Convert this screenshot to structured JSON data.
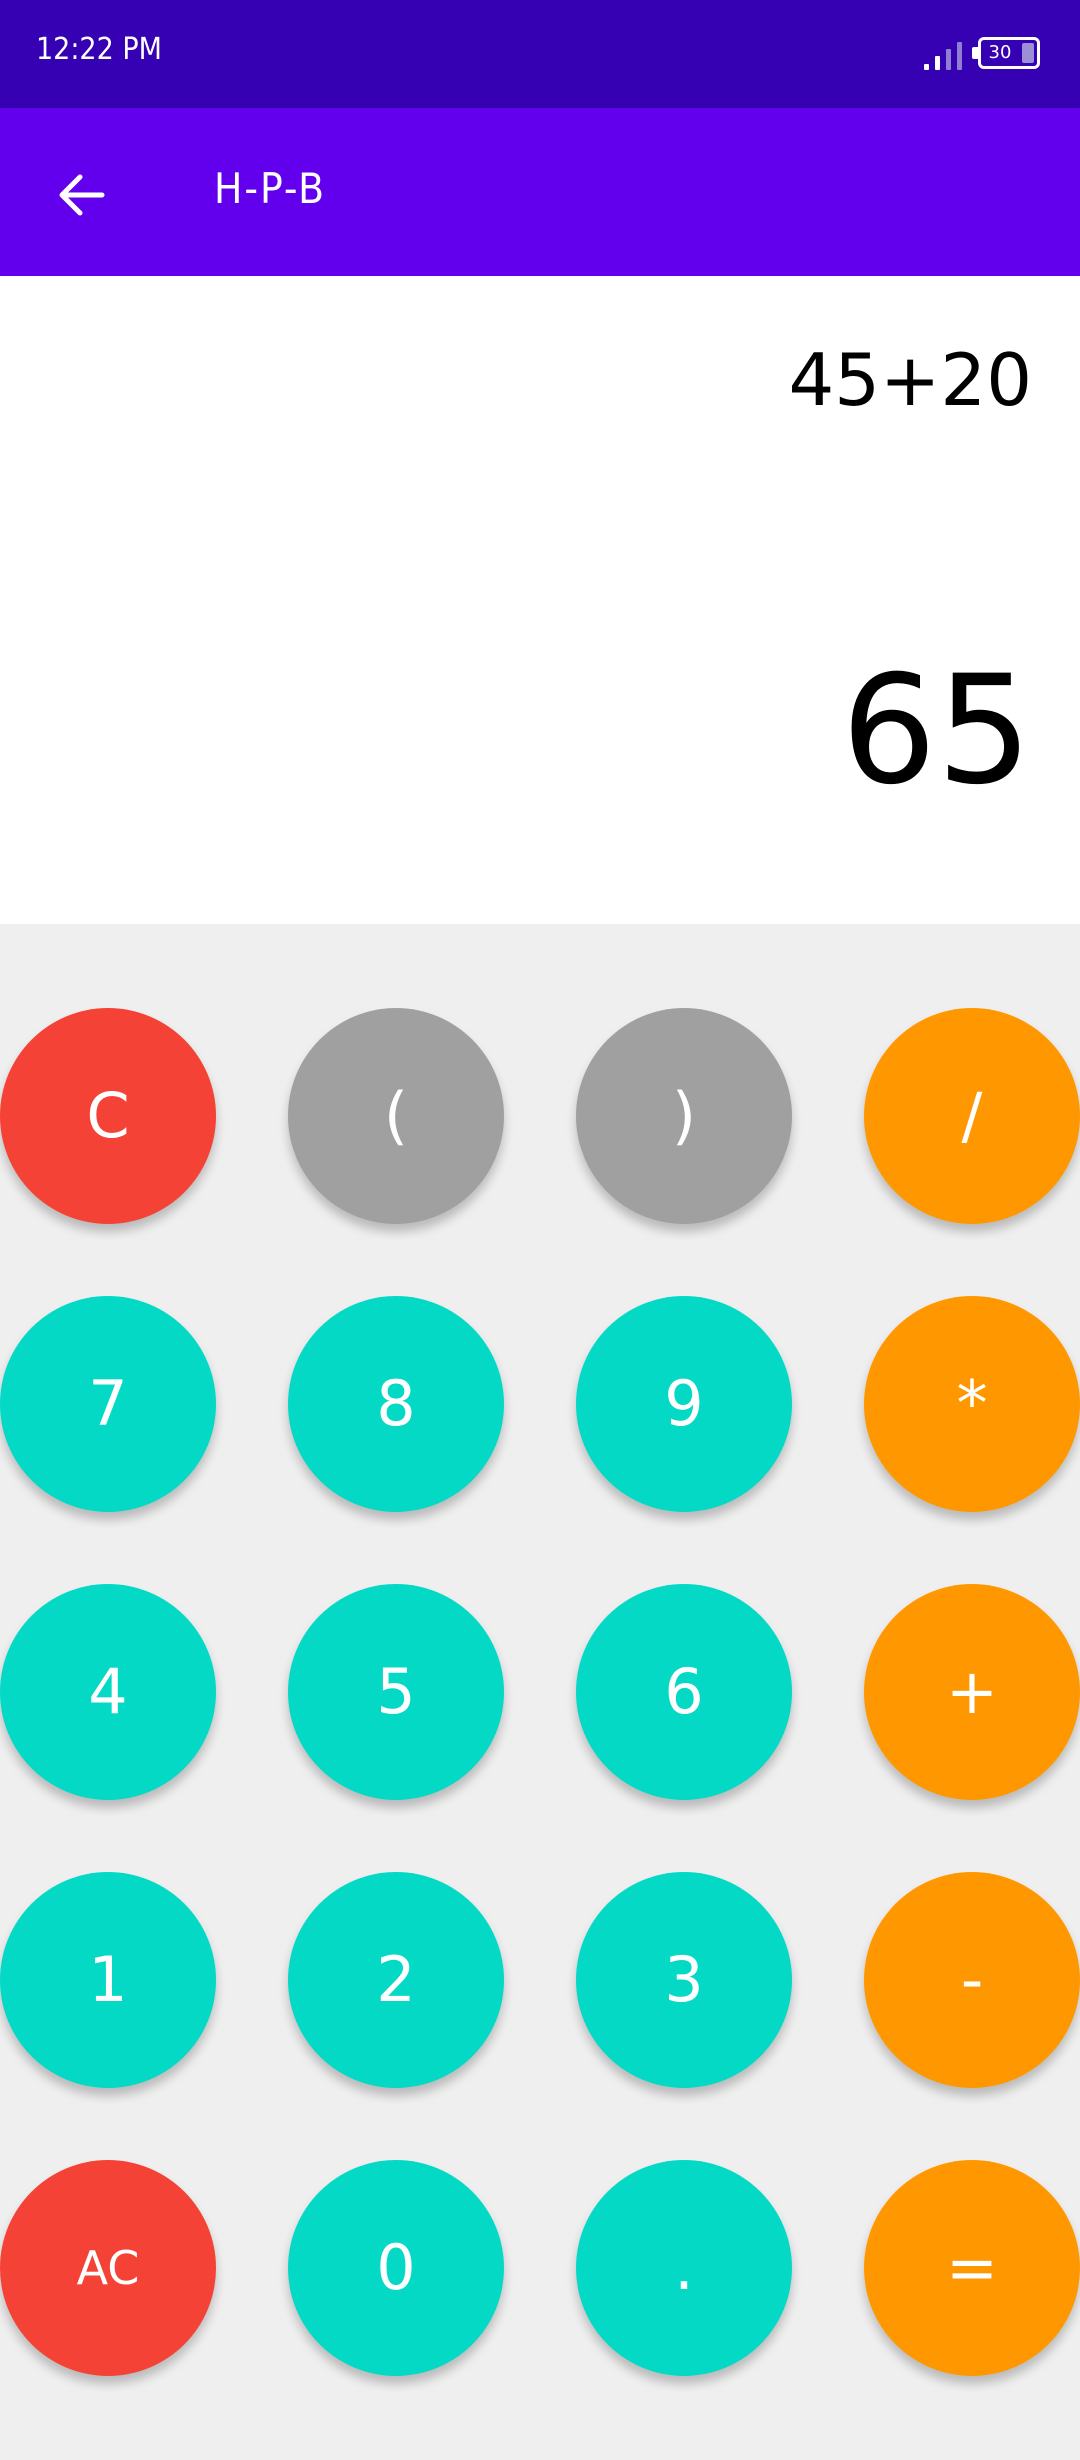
{
  "status_bar": {
    "time": "12:22 PM",
    "battery_level": "30",
    "signal_icon": "signal-strength-icon",
    "battery_icon": "battery-icon"
  },
  "app_bar": {
    "title": "H-P-B",
    "back_icon": "arrow-back-icon"
  },
  "display": {
    "expression": "45+20",
    "result": "65"
  },
  "keypad": {
    "keys": [
      {
        "label": "C",
        "color": "#f44336"
      },
      {
        "label": "(",
        "color": "#a0a0a0"
      },
      {
        "label": ")",
        "color": "#a0a0a0"
      },
      {
        "label": "/",
        "color": "#ff9800"
      },
      {
        "label": "7",
        "color": "#03d9c5"
      },
      {
        "label": "8",
        "color": "#03d9c5"
      },
      {
        "label": "9",
        "color": "#03d9c5"
      },
      {
        "label": "*",
        "color": "#ff9800"
      },
      {
        "label": "4",
        "color": "#03d9c5"
      },
      {
        "label": "5",
        "color": "#03d9c5"
      },
      {
        "label": "6",
        "color": "#03d9c5"
      },
      {
        "label": "+",
        "color": "#ff9800"
      },
      {
        "label": "1",
        "color": "#03d9c5"
      },
      {
        "label": "2",
        "color": "#03d9c5"
      },
      {
        "label": "3",
        "color": "#03d9c5"
      },
      {
        "label": "-",
        "color": "#ff9800"
      },
      {
        "label": "AC",
        "color": "#f44336"
      },
      {
        "label": "0",
        "color": "#03d9c5"
      },
      {
        "label": ".",
        "color": "#03d9c5"
      },
      {
        "label": "=",
        "color": "#ff9800"
      }
    ]
  },
  "colors": {
    "status_bar": "#3600b3",
    "app_bar": "#6200ee",
    "keypad_background": "#efefef",
    "display_background": "#ffffff"
  }
}
